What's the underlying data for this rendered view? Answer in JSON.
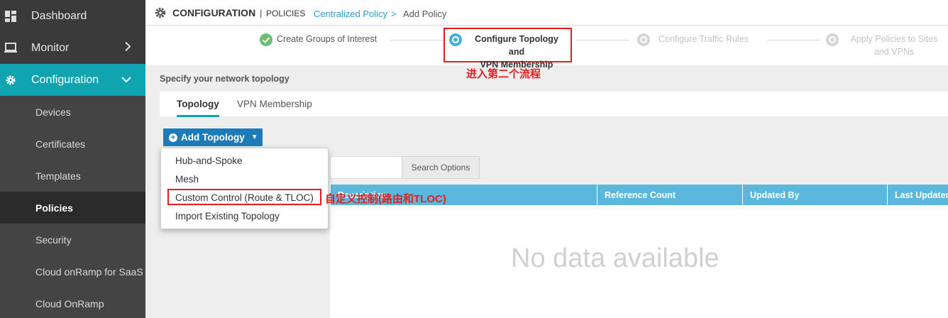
{
  "sidebar": {
    "top_items": [
      {
        "label": "Dashboard",
        "icon": "dashboard-icon"
      },
      {
        "label": "Monitor",
        "icon": "monitor-icon"
      },
      {
        "label": "Configuration",
        "icon": "gear-icon"
      }
    ],
    "sub_items": [
      {
        "label": "Devices"
      },
      {
        "label": "Certificates"
      },
      {
        "label": "Templates"
      },
      {
        "label": "Policies",
        "active": true
      },
      {
        "label": "Security"
      },
      {
        "label": "Cloud onRamp for SaaS"
      },
      {
        "label": "Cloud OnRamp"
      }
    ]
  },
  "header": {
    "title": "CONFIGURATION",
    "separator": "|",
    "subtitle": "POLICIES",
    "breadcrumb": [
      "Centralized Policy",
      "Add Policy"
    ],
    "breadcrumb_sep": ">"
  },
  "stepper": {
    "steps": [
      {
        "label_line1": "Create Groups of Interest",
        "label_line2": "",
        "state": "done"
      },
      {
        "label_line1": "Configure Topology and",
        "label_line2": "VPN Membership",
        "state": "current"
      },
      {
        "label_line1": "Configure Traffic Rules",
        "label_line2": "",
        "state": "future"
      },
      {
        "label_line1": "Apply Policies to Sites",
        "label_line2": "and VPNs",
        "state": "future"
      }
    ]
  },
  "content": {
    "section_title": "Specify your network topology",
    "tabs": [
      {
        "label": "Topology",
        "active": true
      },
      {
        "label": "VPN Membership",
        "active": false
      }
    ],
    "add_button": "Add Topology",
    "search_options": "Search Options",
    "table_headers": [
      "Description",
      "Reference Count",
      "Updated By",
      "Last Updated"
    ],
    "no_data": "No data available"
  },
  "dropdown": {
    "items": [
      "Hub-and-Spoke",
      "Mesh",
      "Custom Control (Route & TLOC)",
      "Import Existing Topology"
    ]
  },
  "annotations": {
    "step_note": "进入第二个流程",
    "item_note": "自定义控制(路由和TLOC)"
  },
  "colors": {
    "accent": "#10a3b0",
    "button": "#1f7bb8",
    "table_header": "#5bb8dc",
    "annotation": "#e02020"
  }
}
